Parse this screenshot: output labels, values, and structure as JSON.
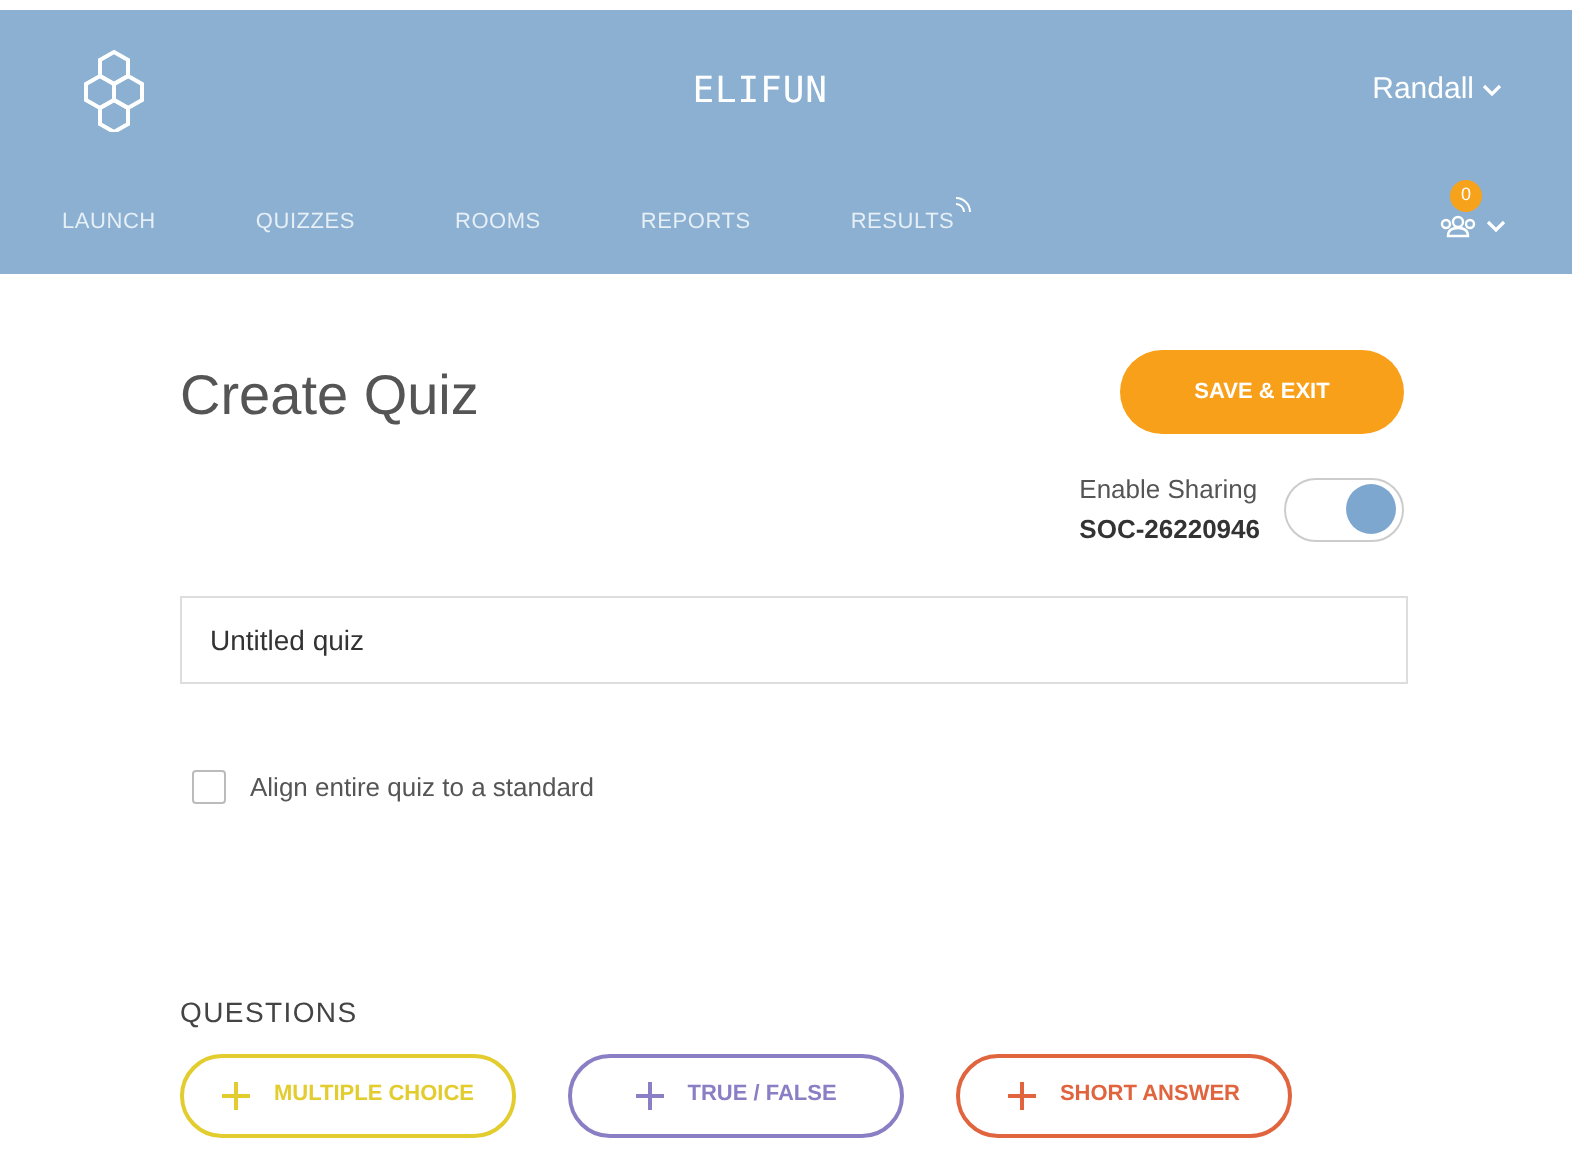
{
  "header": {
    "title": "ELIFUN",
    "user": "Randall",
    "notification_count": "0"
  },
  "nav": [
    {
      "label": "LAUNCH",
      "selected": false
    },
    {
      "label": "QUIZZES",
      "selected": false
    },
    {
      "label": "ROOMS",
      "selected": false
    },
    {
      "label": "REPORTS",
      "selected": false
    },
    {
      "label": "RESULTS",
      "selected": false
    }
  ],
  "page_title": "Create Quiz",
  "save_button": "SAVE & EXIT",
  "sharing": {
    "label": "Enable Sharing",
    "code": "SOC-26220946",
    "on": true
  },
  "quiz_name": {
    "value": "Untitled quiz"
  },
  "align_standard": {
    "label": "Align entire quiz to a standard",
    "checked": false
  },
  "questions": {
    "heading": "QUESTIONS",
    "buttons": [
      {
        "label": "MULTIPLE CHOICE",
        "color": "#e2cc2e"
      },
      {
        "label": "TRUE / FALSE",
        "color": "#8a7fc4"
      },
      {
        "label": "SHORT ANSWER",
        "color": "#e0643e"
      }
    ]
  }
}
